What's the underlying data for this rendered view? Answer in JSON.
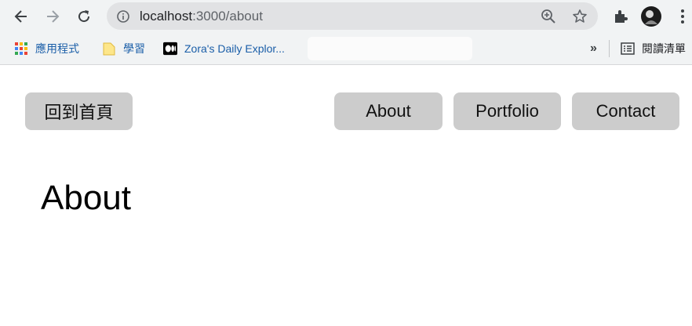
{
  "browser": {
    "url_host": "localhost",
    "url_path": ":3000/about"
  },
  "bookmarks": {
    "items": [
      {
        "label": "應用程式",
        "icon": "apps-grid-icon"
      },
      {
        "label": "學習",
        "icon": "folder-icon"
      },
      {
        "label": "Zora's Daily Explor...",
        "icon": "medium-icon"
      }
    ],
    "overflow_label": "»",
    "reading_list_label": "閱讀清單"
  },
  "page": {
    "home_button": "回到首頁",
    "nav": [
      "About",
      "Portfolio",
      "Contact"
    ],
    "heading": "About"
  },
  "colors": {
    "button_bg": "#cccccc",
    "toolbar_bg": "#f1f3f4"
  }
}
